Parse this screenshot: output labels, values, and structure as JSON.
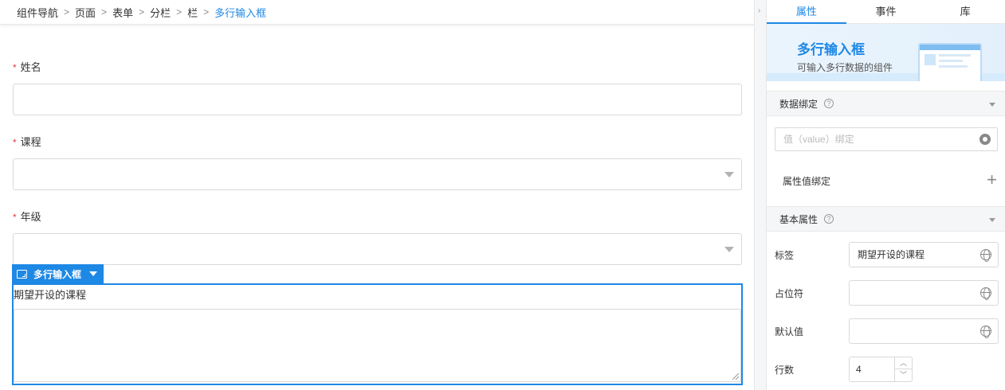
{
  "breadcrumb": [
    "组件导航",
    "页面",
    "表单",
    "分栏",
    "栏",
    "多行输入框"
  ],
  "form": {
    "fields": [
      {
        "label": "姓名",
        "required": "*",
        "type": "input"
      },
      {
        "label": "课程",
        "required": "*",
        "type": "select"
      },
      {
        "label": "年级",
        "required": "*",
        "type": "select"
      }
    ],
    "selected_component": {
      "tag_label": "多行输入框",
      "textarea_label": "期望开设的课程"
    }
  },
  "panel": {
    "tabs": [
      "属性",
      "事件",
      "库"
    ],
    "active_tab": "属性",
    "hero": {
      "title": "多行输入框",
      "desc": "可输入多行数据的组件"
    },
    "data_binding": {
      "title": "数据绑定",
      "help": "?",
      "value_placeholder": "值（value）绑定",
      "attr_binding_label": "属性值绑定",
      "add_symbol": "+"
    },
    "basic": {
      "title": "基本属性",
      "help": "?",
      "label_key": "标签",
      "label_value": "期望开设的课程",
      "placeholder_key": "占位符",
      "placeholder_value": "",
      "default_key": "默认值",
      "default_value": "",
      "rows_key": "行数",
      "rows_value": "4"
    }
  },
  "colors": {
    "accent": "#1e88e5",
    "required": "#e53935"
  }
}
